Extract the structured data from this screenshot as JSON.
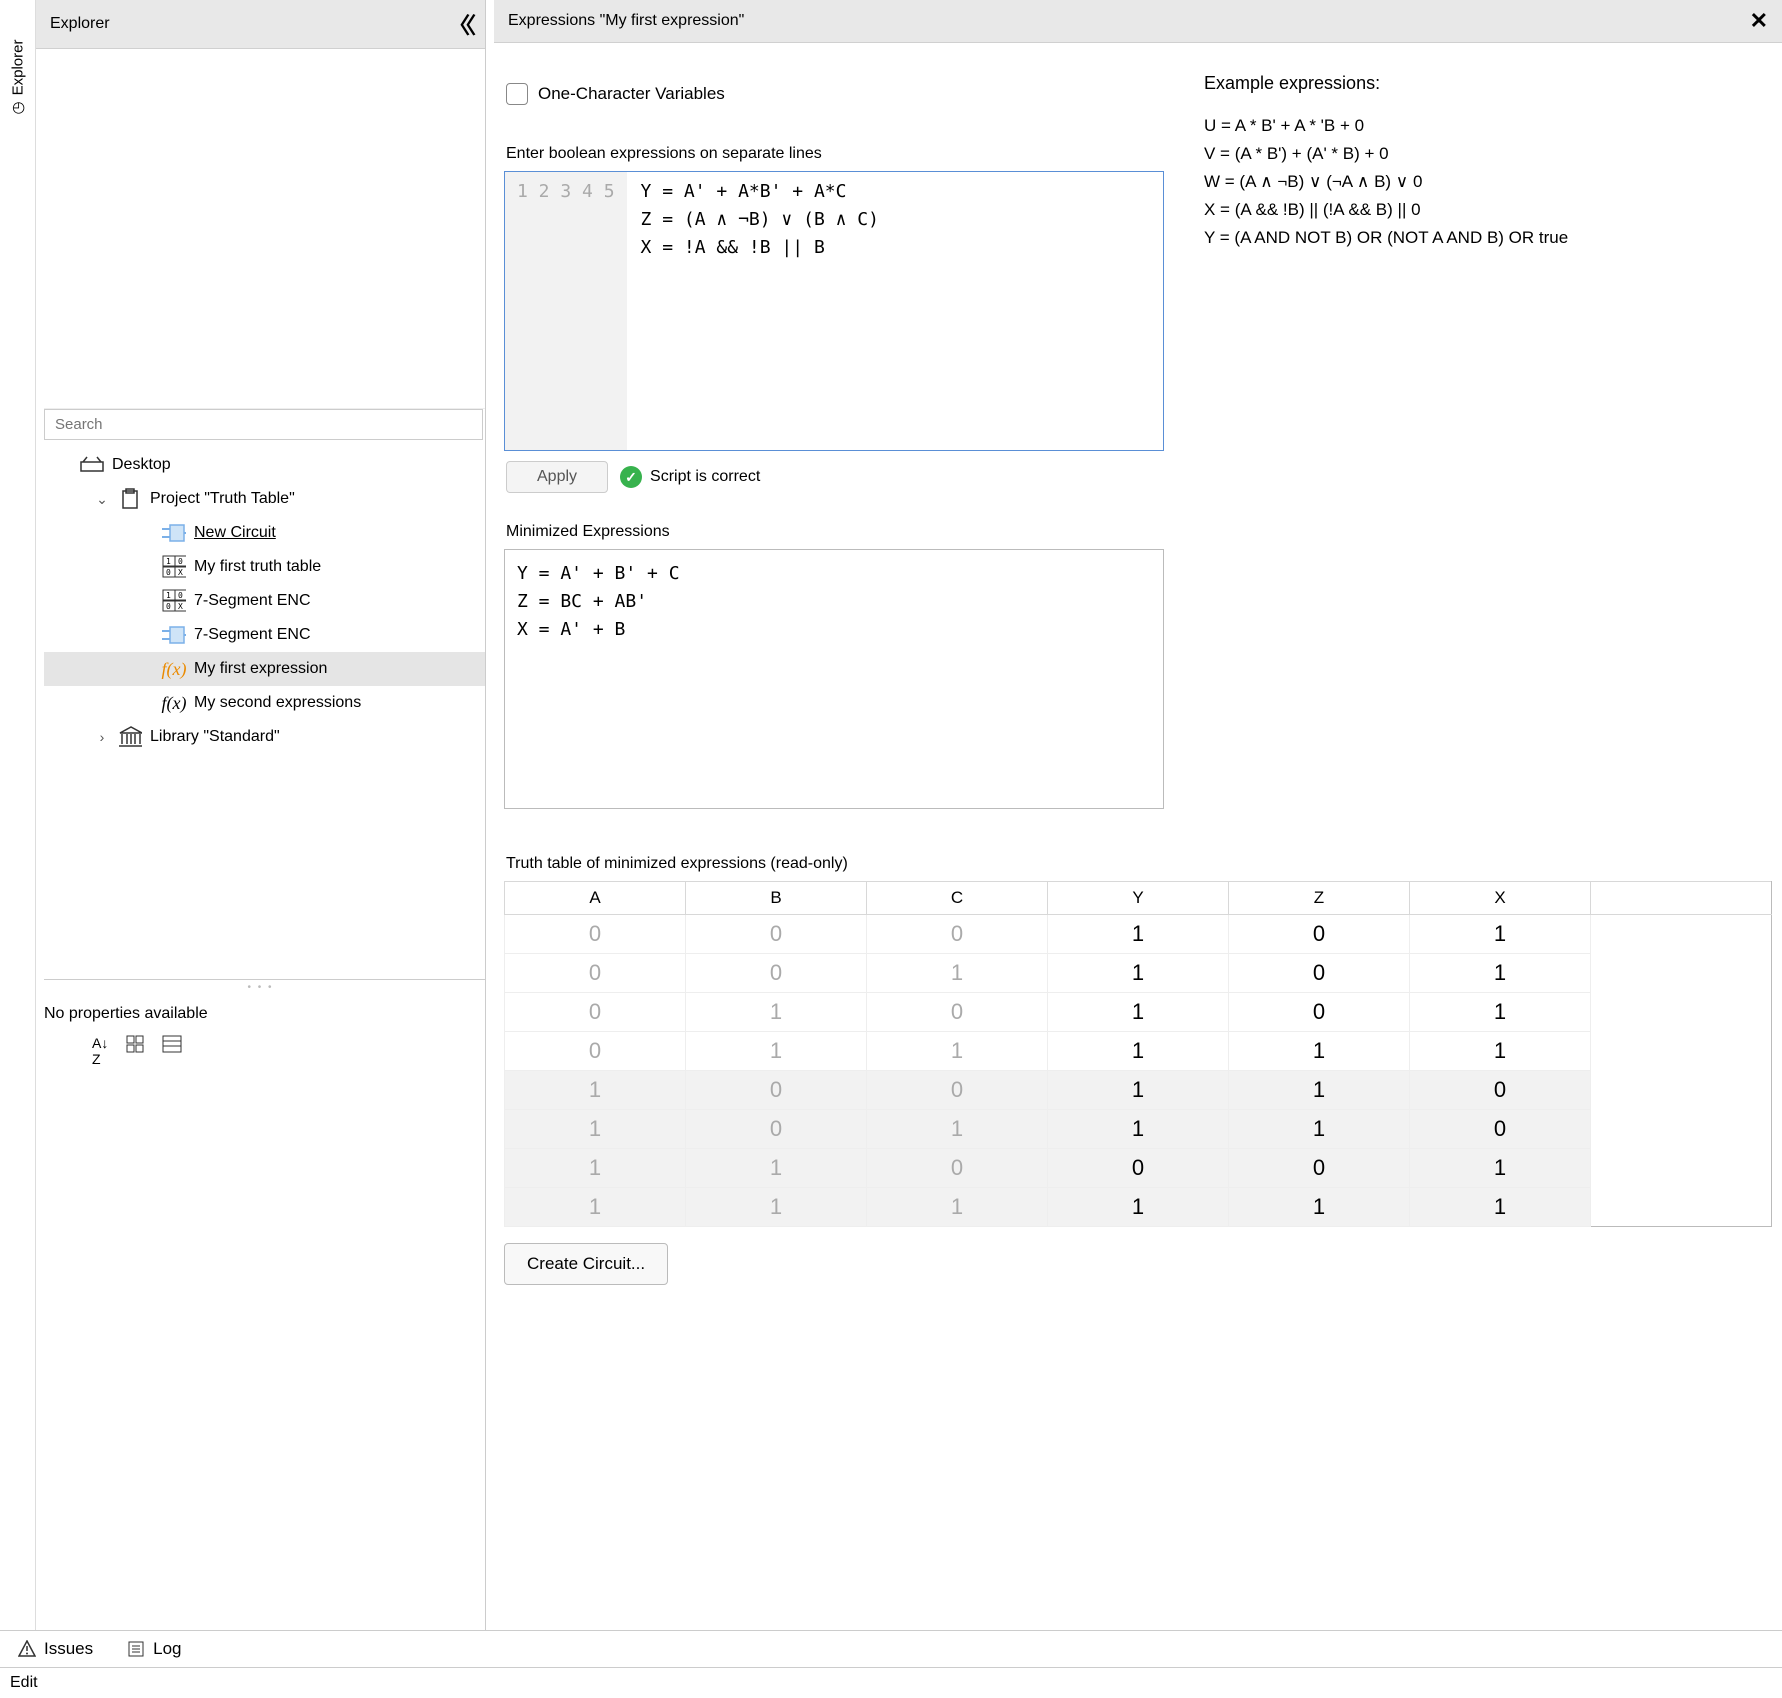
{
  "vert_tab_label": "Explorer",
  "explorer": {
    "title": "Explorer",
    "search_placeholder": "Search",
    "tree": [
      {
        "depth": 1,
        "icon": "desktop",
        "label": "Desktop",
        "chevron": ""
      },
      {
        "depth": 2,
        "icon": "project",
        "label": "Project \"Truth Table\"",
        "chevron": "down"
      },
      {
        "depth": 3,
        "icon": "circuit",
        "label": "New Circuit",
        "underline": true
      },
      {
        "depth": 3,
        "icon": "tt",
        "label": "My first truth table"
      },
      {
        "depth": 3,
        "icon": "tt",
        "label": "7-Segment ENC"
      },
      {
        "depth": 3,
        "icon": "circuit",
        "label": "7-Segment ENC"
      },
      {
        "depth": 3,
        "icon": "fx-orange",
        "label": "My first expression",
        "selected": true
      },
      {
        "depth": 3,
        "icon": "fx",
        "label": "My second expressions"
      },
      {
        "depth": 2,
        "icon": "library",
        "label": "Library \"Standard\"",
        "chevron": "right"
      }
    ],
    "props_label": "No properties available"
  },
  "main": {
    "title": "Expressions \"My first expression\"",
    "one_char_label": "One-Character Variables",
    "enter_label": "Enter boolean expressions on separate lines",
    "lines": [
      "1",
      "2",
      "3",
      "4",
      "5"
    ],
    "code": "Y = A' + A*B' + A*C\nZ = (A ∧ ¬B) ∨ (B ∧ C)\nX = !A && !B || B",
    "apply_label": "Apply",
    "script_status": "Script is correct",
    "min_label": "Minimized Expressions",
    "min_code": "Y = A' + B' + C\nZ = BC + AB'\nX = A' + B",
    "examples_head": "Example expressions:",
    "examples": [
      "U = A * B' + A * 'B + 0",
      "V = (A * B') + (A' * B) + 0",
      "W = (A ∧ ¬B) ∨ (¬A ∧ B) ∨ 0",
      "X = (A && !B) || (!A && B) || 0",
      "Y = (A AND NOT B) OR (NOT A AND B) OR true"
    ],
    "truth_label": "Truth table of minimized expressions (read-only)",
    "truth_headers": [
      "A",
      "B",
      "C",
      "Y",
      "Z",
      "X"
    ],
    "truth_rows": [
      {
        "in": [
          "0",
          "0",
          "0"
        ],
        "out": [
          "1",
          "0",
          "1"
        ],
        "shade": false
      },
      {
        "in": [
          "0",
          "0",
          "1"
        ],
        "out": [
          "1",
          "0",
          "1"
        ],
        "shade": false
      },
      {
        "in": [
          "0",
          "1",
          "0"
        ],
        "out": [
          "1",
          "0",
          "1"
        ],
        "shade": false
      },
      {
        "in": [
          "0",
          "1",
          "1"
        ],
        "out": [
          "1",
          "1",
          "1"
        ],
        "shade": false
      },
      {
        "in": [
          "1",
          "0",
          "0"
        ],
        "out": [
          "1",
          "1",
          "0"
        ],
        "shade": true
      },
      {
        "in": [
          "1",
          "0",
          "1"
        ],
        "out": [
          "1",
          "1",
          "0"
        ],
        "shade": true
      },
      {
        "in": [
          "1",
          "1",
          "0"
        ],
        "out": [
          "0",
          "0",
          "1"
        ],
        "shade": true
      },
      {
        "in": [
          "1",
          "1",
          "1"
        ],
        "out": [
          "1",
          "1",
          "1"
        ],
        "shade": true
      }
    ],
    "create_label": "Create Circuit..."
  },
  "bottom": {
    "issues": "Issues",
    "log": "Log"
  },
  "status_bar": "Edit"
}
